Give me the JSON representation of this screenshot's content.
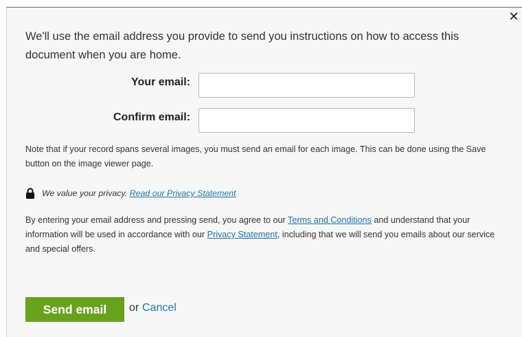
{
  "dialog": {
    "intro": "We'll use the email address you provide to send you instructions on how to access this document when you are home.",
    "close_icon": "close-icon",
    "form": {
      "email_label": "Your email:",
      "email_value": "",
      "confirm_label": "Confirm email:",
      "confirm_value": ""
    },
    "note": "Note that if your record spans several images, you must send an email for each image. This can be done using the Save button on the image viewer page.",
    "privacy": {
      "icon": "lock-icon",
      "text": "We value your privacy.",
      "link": "Read our Privacy Statement"
    },
    "terms": {
      "part1": "By entering your email address and pressing send, you agree to our",
      "terms_link": "Terms and Conditions",
      "part2": "and understand that your information will be used in accordance with our",
      "privacy_link": "Privacy Statement",
      "part3": ", including that we will send you emails about our service and special offers."
    },
    "actions": {
      "send_label": "Send email",
      "or_label": "or",
      "cancel_label": "Cancel"
    },
    "colors": {
      "send_button": "#68a21c",
      "link": "#1f73a5",
      "background": "#f7f7f7"
    }
  }
}
